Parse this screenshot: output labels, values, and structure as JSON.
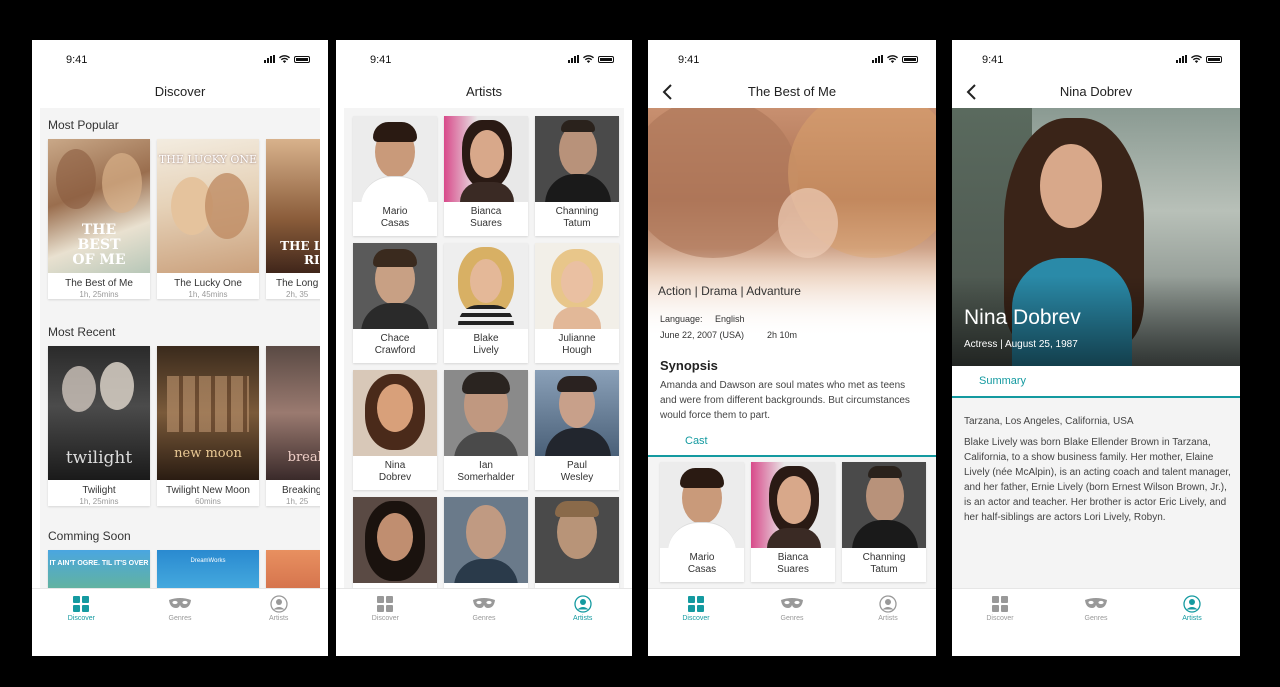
{
  "status": {
    "time": "9:41"
  },
  "tabs": {
    "discover": "Discover",
    "genres": "Genres",
    "artists": "Artists"
  },
  "colors": {
    "accent": "#149aa0"
  },
  "screen1": {
    "title": "Discover",
    "sections": [
      {
        "heading": "Most Popular",
        "cards": [
          {
            "title": "The Best of Me",
            "duration": "1h, 25mins",
            "poster_text": "THE BEST OF ME"
          },
          {
            "title": "The Lucky One",
            "duration": "1h, 45mins",
            "poster_text": "THE LUCKY ONE"
          },
          {
            "title": "The Long",
            "duration": "2h, 35",
            "poster_text": "THE LONG RID"
          }
        ]
      },
      {
        "heading": "Most Recent",
        "cards": [
          {
            "title": "Twilight",
            "duration": "1h, 25mins",
            "poster_text": "twilight"
          },
          {
            "title": "Twilight New Moon",
            "duration": "60mins",
            "poster_text": "new moon"
          },
          {
            "title": "Breaking",
            "duration": "1h, 25",
            "poster_text": "breaking"
          }
        ]
      },
      {
        "heading": "Comming Soon",
        "cards": [
          {
            "poster_text": "IT AIN'T OGRE. TIL IT'S OVER"
          },
          {
            "poster_text": "DreamWorks"
          },
          {
            "poster_text": ""
          }
        ]
      }
    ]
  },
  "screen2": {
    "title": "Artists",
    "artists": [
      {
        "first": "Mario",
        "last": "Casas"
      },
      {
        "first": "Bianca",
        "last": "Suares"
      },
      {
        "first": "Channing",
        "last": "Tatum"
      },
      {
        "first": "Chace",
        "last": "Crawford"
      },
      {
        "first": "Blake",
        "last": "Lively"
      },
      {
        "first": "Julianne",
        "last": "Hough"
      },
      {
        "first": "Nina",
        "last": "Dobrev"
      },
      {
        "first": "Ian",
        "last": "Somerhalder"
      },
      {
        "first": "Paul",
        "last": "Wesley"
      },
      {
        "first": "",
        "last": ""
      },
      {
        "first": "",
        "last": ""
      },
      {
        "first": "",
        "last": ""
      }
    ]
  },
  "screen3": {
    "title": "The Best of Me",
    "genres": "Action | Drama | Advanture",
    "language_label": "Language:",
    "language": "English",
    "release": "June 22, 2007 (USA)",
    "runtime": "2h 10m",
    "synopsis_heading": "Synopsis",
    "synopsis": "Amanda and Dawson are soul mates who met as teens and were from different backgrounds. But circumstances would force them to part.",
    "cast_tab": "Cast",
    "cast": [
      {
        "first": "Mario",
        "last": "Casas"
      },
      {
        "first": "Bianca",
        "last": "Suares"
      },
      {
        "first": "Channing",
        "last": "Tatum"
      }
    ]
  },
  "screen4": {
    "title": "Nina Dobrev",
    "name": "Nina Dobrev",
    "subtitle": "Actress | August 25, 1987",
    "summary_tab": "Summary",
    "birthplace": "Tarzana, Los Angeles, California, USA",
    "bio": "Blake Lively was born Blake Ellender Brown in Tarzana, California, to a show business family. Her mother, Elaine Lively (née McAlpin), is an acting coach and talent manager, and her father, Ernie Lively (born Ernest Wilson Brown, Jr.), is an actor and teacher. Her brother is actor Eric Lively, and her half-siblings are actors Lori Lively, Robyn."
  }
}
